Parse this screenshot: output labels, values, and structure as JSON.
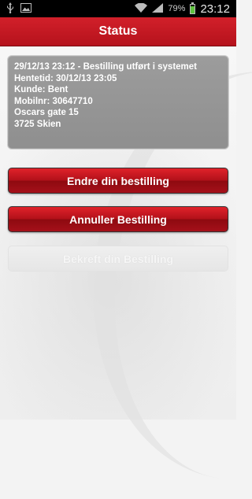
{
  "status_bar": {
    "icons": [
      "usb-icon",
      "image-icon",
      "wifi-icon",
      "signal-icon",
      "battery-icon"
    ],
    "battery_percent": "79%",
    "battery_level": 0.79,
    "time": "23:12"
  },
  "header": {
    "title": "Status"
  },
  "order_info": {
    "lines": [
      "29/12/13 23:12 - Bestilling utført i systemet",
      "Hentetid: 30/12/13 23:05",
      "Kunde: Bent",
      "Mobilnr: 30647710",
      "Oscars gate 15",
      "3725 Skien"
    ]
  },
  "actions": {
    "change_label": "Endre din bestilling",
    "cancel_label": "Annuller Bestilling",
    "confirm_label": "Bekreft din Bestilling",
    "confirm_enabled": false
  },
  "colors": {
    "header": "#c5161f",
    "button": "#b3111a",
    "panel": "#969696"
  }
}
